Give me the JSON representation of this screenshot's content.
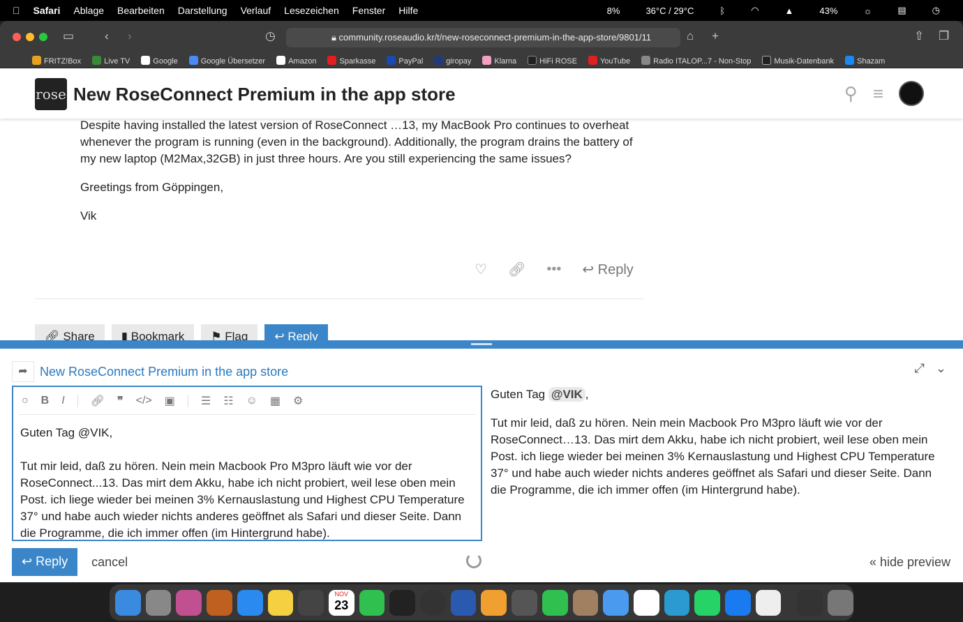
{
  "menubar": {
    "app": "Safari",
    "items": [
      "Ablage",
      "Bearbeiten",
      "Darstellung",
      "Verlauf",
      "Lesezeichen",
      "Fenster",
      "Hilfe"
    ],
    "status": {
      "cpu": "8%",
      "temp": "36°C / 29°C",
      "battery": "43%"
    }
  },
  "browser": {
    "url": "community.roseaudio.kr/t/new-roseconnect-premium-in-the-app-store/9801/11"
  },
  "bookmarks": [
    {
      "label": "FRITZ!Box",
      "color": "#e8a020"
    },
    {
      "label": "Live TV",
      "color": "#3a8a3a"
    },
    {
      "label": "Google",
      "color": "#fff"
    },
    {
      "label": "Google Übersetzer",
      "color": "#4a8af4"
    },
    {
      "label": "Amazon",
      "color": "#fff"
    },
    {
      "label": "Sparkasse",
      "color": "#e02020"
    },
    {
      "label": "PayPal",
      "color": "#1a4ab0"
    },
    {
      "label": "giropay",
      "color": "#233a7a"
    },
    {
      "label": "Klarna",
      "color": "#f0a0c0"
    },
    {
      "label": "HiFi ROSE",
      "color": "#222"
    },
    {
      "label": "YouTube",
      "color": "#e02020"
    },
    {
      "label": "Radio ITALOP...7 - Non-Stop",
      "color": "#888"
    },
    {
      "label": "Musik-Datenbank",
      "color": "#222"
    },
    {
      "label": "Shazam",
      "color": "#1a8af0"
    }
  ],
  "header": {
    "logo": "rose",
    "title": "New RoseConnect Premium in the app store"
  },
  "post": {
    "paragraphs": [
      "Despite having installed the latest version of RoseConnect …13, my MacBook Pro continues to overheat whenever the program is running (even in the background). Additionally, the program drains the battery of my new laptop (M2Max,32GB) in just three hours. Are you still experiencing the same issues?",
      "Greetings from Göppingen,",
      "Vik"
    ],
    "reply_label": "Reply"
  },
  "topic_buttons": {
    "share": "Share",
    "bookmark": "Bookmark",
    "flag": "Flag",
    "reply": "Reply"
  },
  "composer": {
    "topic_title": "New RoseConnect Premium in the app store",
    "editor_text": "Guten Tag @VIK,\n\nTut mir leid, daß zu hören. Nein mein Macbook Pro M3pro läuft wie vor der RoseConnect...13. Das mirt dem Akku, habe ich nicht probiert, weil lese oben mein Post. ich liege wieder bei meinen 3% Kernauslastung und Highest CPU Temperature 37° und habe auch wieder nichts anderes geöffnet als Safari und dieser Seite. Dann die Programme, die ich immer offen (im Hintergrund habe).",
    "preview_greeting": "Guten Tag",
    "preview_mention": "@VIK",
    "preview_body": "Tut mir leid, daß zu hören. Nein mein Macbook Pro M3pro läuft wie vor der RoseConnect…13. Das mirt dem Akku, habe ich nicht probiert, weil lese oben mein Post. ich liege wieder bei meinen 3% Kernauslastung und Highest CPU Temperature 37° und habe auch wieder nichts anderes geöffnet als Safari und dieser Seite. Dann die Programme, die ich immer offen (im Hintergrund habe).",
    "reply": "Reply",
    "cancel": "cancel",
    "hide_preview": "« hide preview"
  },
  "dock": {
    "calendar_month": "NOV",
    "calendar_day": "23"
  }
}
